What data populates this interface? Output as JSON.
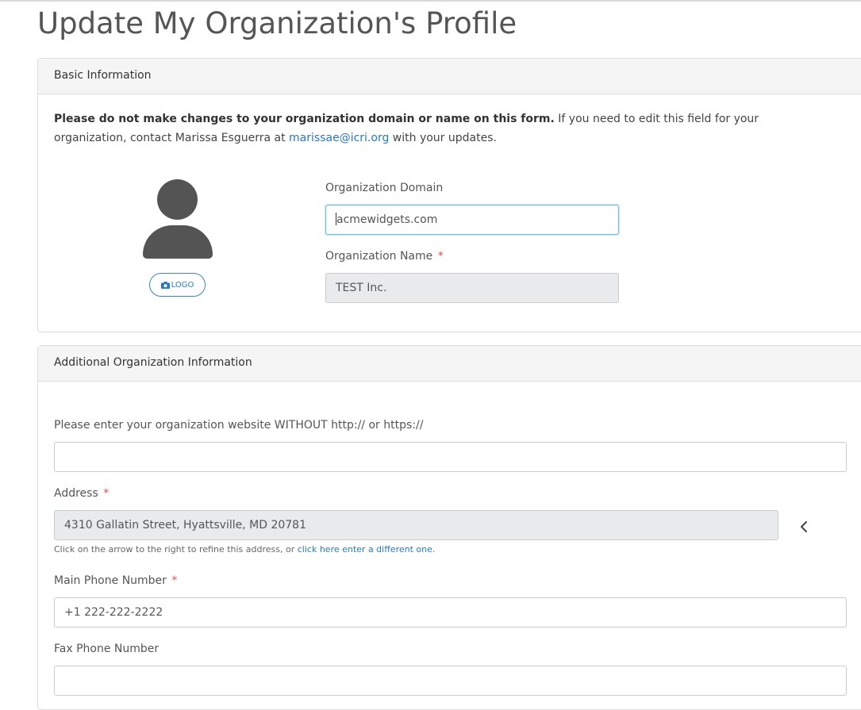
{
  "page": {
    "title": "Update My Organization's Profile"
  },
  "basic": {
    "header": "Basic Information",
    "notice_bold": "Please do not make changes to your organization domain or name on this form.",
    "notice_text": " If you need to edit this field for your organization, contact Marissa Esguerra at ",
    "notice_email": "marissae@icri.org",
    "notice_end": " with your updates.",
    "logo_label": "LOGO",
    "domain_label": "Organization Domain",
    "domain_value": "acmewidgets.com",
    "name_label": "Organization Name",
    "name_value": "TEST Inc.",
    "required_mark": "*"
  },
  "additional": {
    "header": "Additional Organization Information",
    "website_label": "Please enter your organization website WITHOUT http:// or https://",
    "website_value": "",
    "address_label": "Address",
    "address_value": "4310 Gallatin Street, Hyattsville, MD 20781",
    "address_help": "Click on the arrow to the right to refine this address, or ",
    "address_help_link": "click here enter a different one",
    "address_help_end": ".",
    "phone_label": "Main Phone Number",
    "phone_value": "+1 222-222-2222",
    "fax_label": "Fax Phone Number",
    "fax_value": "",
    "required_mark": "*"
  },
  "colors": {
    "link": "#2a7ab8",
    "required": "#d9534f",
    "focus_border": "#66c2e0"
  },
  "icons": [
    "user-avatar-icon",
    "camera-icon",
    "chevron-left-icon"
  ]
}
